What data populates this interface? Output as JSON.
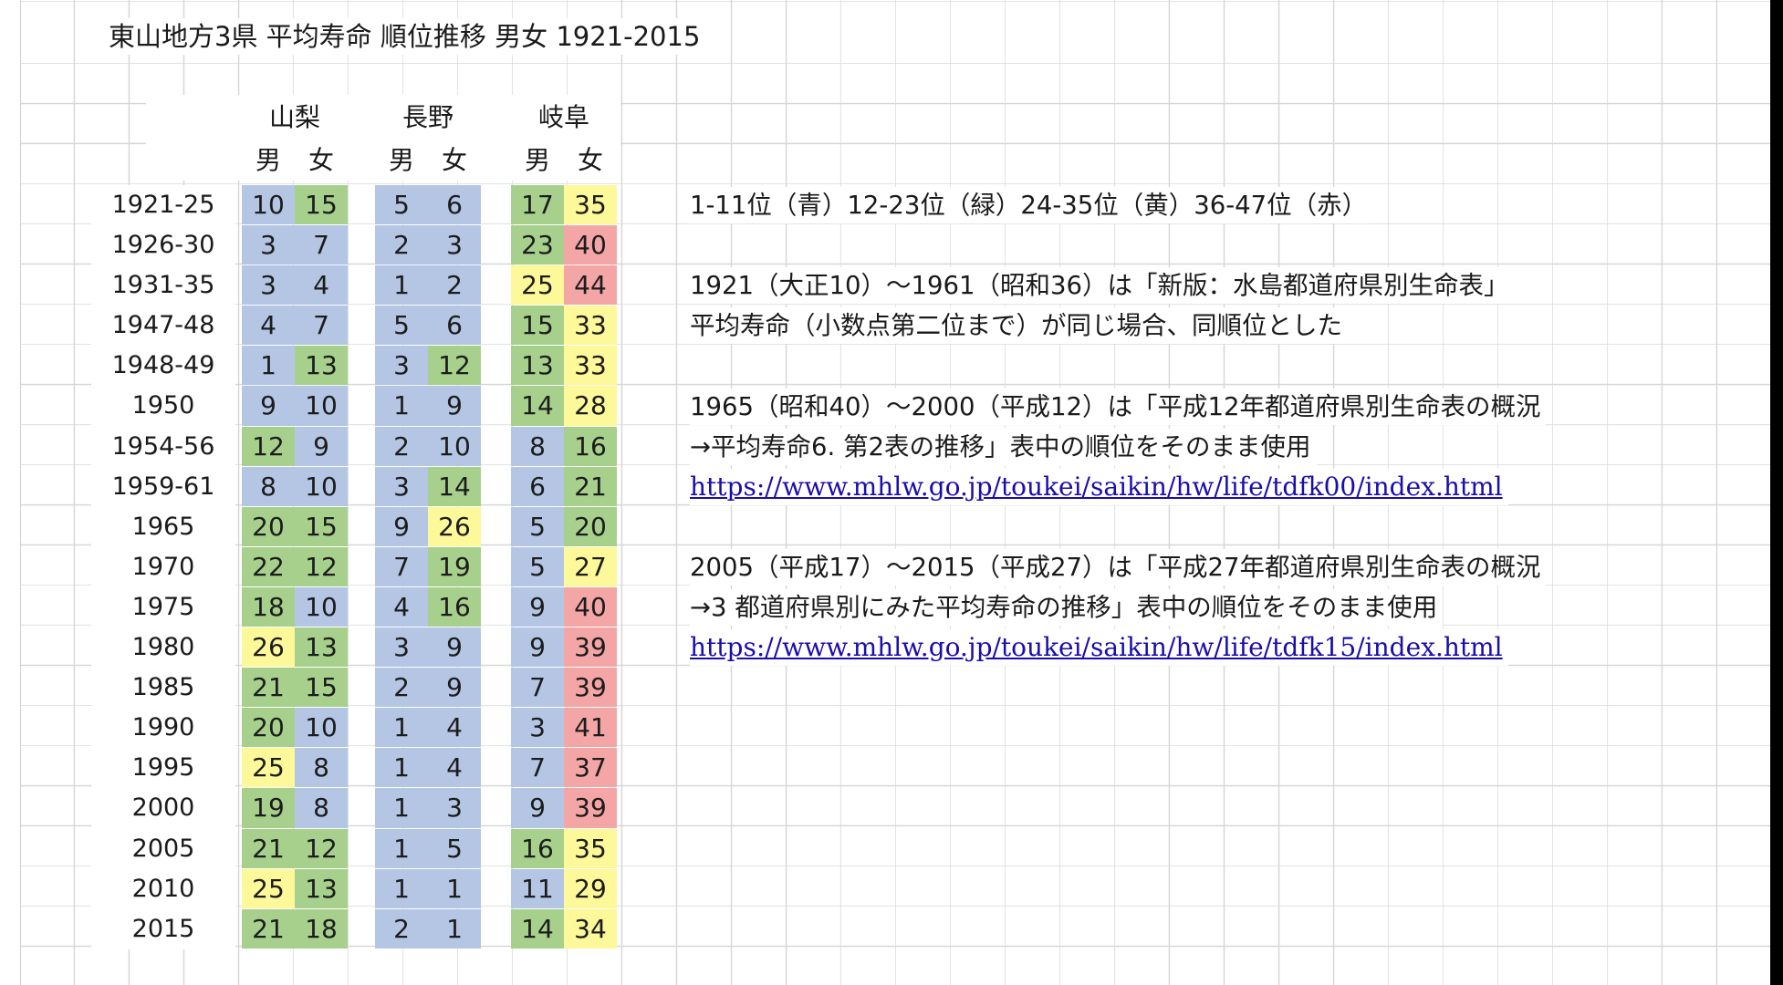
{
  "title": "東山地方3県 平均寿命 順位推移 男女 1921-2015",
  "colors": {
    "blue": "#b4c6e4",
    "green": "#a7d08c",
    "yellow": "#fdf89a",
    "red": "#f4a6a6"
  },
  "prefectures": [
    "山梨",
    "長野",
    "岐阜"
  ],
  "sexes": [
    "男",
    "女"
  ],
  "years": [
    "1921-25",
    "1926-30",
    "1931-35",
    "1947-48",
    "1948-49",
    "1950",
    "1954-56",
    "1959-61",
    "1965",
    "1970",
    "1975",
    "1980",
    "1985",
    "1990",
    "1995",
    "2000",
    "2005",
    "2010",
    "2015"
  ],
  "ranks": [
    {
      "prefecture": "山梨",
      "sex": "男",
      "values": [
        10,
        3,
        3,
        4,
        1,
        9,
        12,
        8,
        20,
        22,
        18,
        26,
        21,
        20,
        25,
        19,
        21,
        25,
        21
      ]
    },
    {
      "prefecture": "山梨",
      "sex": "女",
      "values": [
        15,
        7,
        4,
        7,
        13,
        10,
        9,
        10,
        15,
        12,
        10,
        13,
        15,
        10,
        8,
        8,
        12,
        13,
        18
      ]
    },
    {
      "prefecture": "長野",
      "sex": "男",
      "values": [
        5,
        2,
        1,
        5,
        3,
        1,
        2,
        3,
        9,
        7,
        4,
        3,
        2,
        1,
        1,
        1,
        1,
        1,
        2
      ]
    },
    {
      "prefecture": "長野",
      "sex": "女",
      "values": [
        6,
        3,
        2,
        6,
        12,
        9,
        10,
        14,
        26,
        19,
        16,
        9,
        9,
        4,
        4,
        3,
        5,
        1,
        1
      ]
    },
    {
      "prefecture": "岐阜",
      "sex": "男",
      "values": [
        17,
        23,
        25,
        15,
        13,
        14,
        8,
        6,
        5,
        5,
        9,
        9,
        7,
        3,
        7,
        9,
        16,
        11,
        14
      ]
    },
    {
      "prefecture": "岐阜",
      "sex": "女",
      "values": [
        35,
        40,
        44,
        33,
        33,
        28,
        16,
        21,
        20,
        27,
        40,
        39,
        39,
        41,
        37,
        39,
        35,
        29,
        34
      ]
    }
  ],
  "notes": [
    {
      "row": 0,
      "text": "1-11位（青）12-23位（緑）24-35位（黄）36-47位（赤）"
    },
    {
      "row": 2,
      "text": "1921（大正10）～1961（昭和36）は「新版：水島都道府県別生命表」"
    },
    {
      "row": 3,
      "text": "平均寿命（小数点第二位まで）が同じ場合、同順位とした"
    },
    {
      "row": 5,
      "text": "1965（昭和40）～2000（平成12）は「平成12年都道府県別生命表の概況"
    },
    {
      "row": 6,
      "text": "→平均寿命6. 第2表の推移」表中の順位をそのまま使用"
    },
    {
      "row": 7,
      "text": "https://www.mhlw.go.jp/toukei/saikin/hw/life/tdfk00/index.html",
      "link": true
    },
    {
      "row": 9,
      "text": "2005（平成17）～2015（平成27）は「平成27年都道府県別生命表の概況"
    },
    {
      "row": 10,
      "text": "→3 都道府県別にみた平均寿命の推移」表中の順位をそのまま使用"
    },
    {
      "row": 11,
      "text": "https://www.mhlw.go.jp/toukei/saikin/hw/life/tdfk15/index.html ",
      "link": true
    }
  ]
}
